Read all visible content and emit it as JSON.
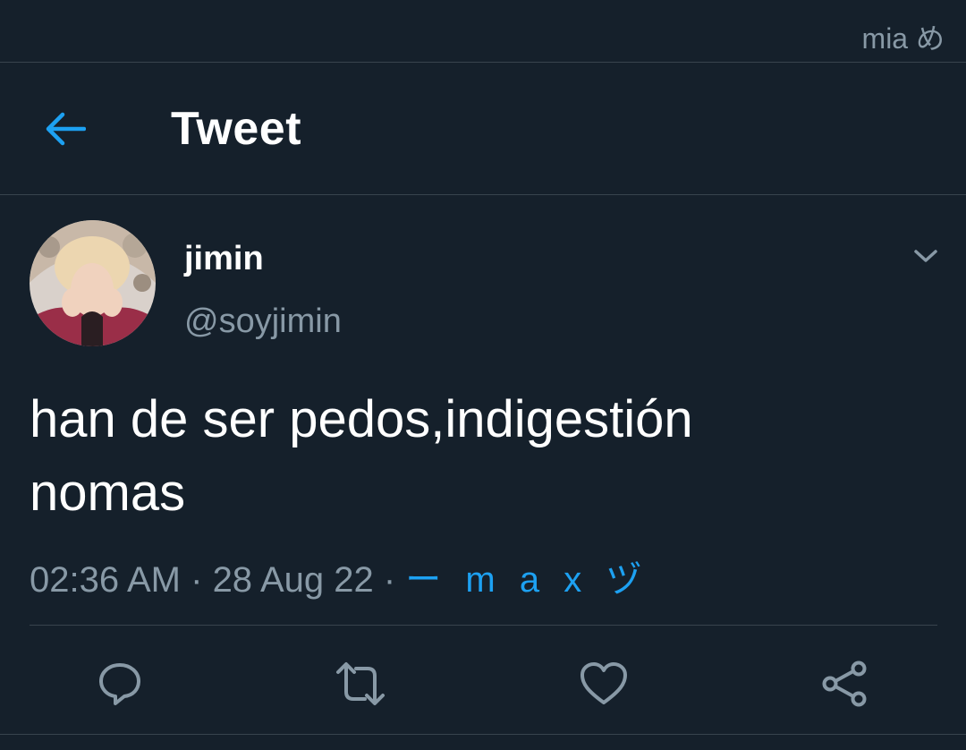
{
  "status_bar": {
    "right_text": "mia め"
  },
  "header": {
    "back_icon": "arrow-left-icon",
    "title": "Tweet"
  },
  "tweet": {
    "author": {
      "name": "jimin",
      "handle": "@soyjimin",
      "avatar_icon": "profile-photo"
    },
    "text_line1": "han de ser pedos,indigestión",
    "text_line2": "nomas",
    "time": "02:36 AM",
    "date": "28 Aug 22",
    "separator": " · ",
    "source": "ー m a x ヅ",
    "caret_icon": "chevron-down-icon"
  },
  "actions": {
    "reply_icon": "reply-icon",
    "retweet_icon": "retweet-icon",
    "like_icon": "heart-icon",
    "share_icon": "share-icon"
  },
  "colors": {
    "background": "#15202b",
    "accent": "#1da1f2",
    "secondary_text": "#8899a6",
    "divider": "#38444d"
  }
}
